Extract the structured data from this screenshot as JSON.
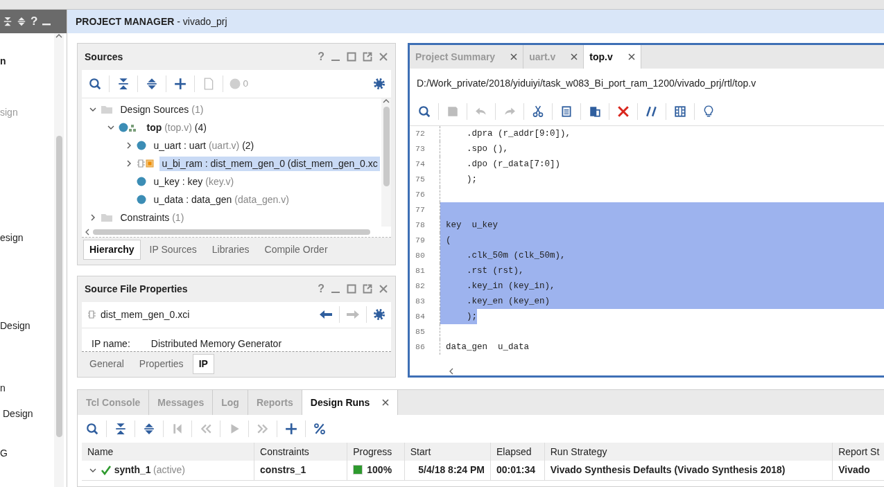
{
  "flow_navigator": {
    "help": "?",
    "items": [
      {
        "label": "n",
        "kind": "heading",
        "disabled": false
      },
      {
        "label": "sign",
        "kind": "item",
        "disabled": true
      },
      {
        "label": "esign",
        "kind": "item",
        "disabled": false
      },
      {
        "label": "Design",
        "kind": "item",
        "disabled": false
      },
      {
        "label": "n",
        "kind": "item",
        "disabled": false
      },
      {
        "label": "Design",
        "kind": "sub",
        "disabled": false
      },
      {
        "label": "G",
        "kind": "item",
        "disabled": false
      }
    ]
  },
  "header": {
    "title": "**PROJECT MANAGER** - vivado_prj"
  },
  "sources": {
    "title": "Sources",
    "help": "?",
    "toolbar": [
      {
        "kind": "search",
        "disabled": false
      },
      {
        "kind": "collapse",
        "disabled": false
      },
      {
        "kind": "expand",
        "disabled": false
      },
      {
        "kind": "plus",
        "disabled": false
      },
      {
        "kind": "doc",
        "disabled": true
      }
    ],
    "badge_count": "0",
    "tree": [
      {
        "label": "Design Sources",
        "count": "(1)",
        "kind": "folder",
        "expanded": true,
        "selected": false,
        "children": [
          {
            "label": "top",
            "file": "(top.v)",
            "count": "(4)",
            "kind": "top",
            "expanded": true,
            "selected": false,
            "children": [
              {
                "label": "u_uart : uart",
                "file": "(uart.v)",
                "count": "(2)",
                "kind": "module",
                "expanded": false,
                "selected": false
              },
              {
                "label": "u_bi_ram : dist_mem_gen_0 (dist_mem_gen_0.xc",
                "kind": "ip",
                "expanded": false,
                "selected": true
              },
              {
                "label": "u_key : key",
                "file": "(key.v)",
                "kind": "module",
                "selected": false
              },
              {
                "label": "u_data : data_gen",
                "file": "(data_gen.v)",
                "kind": "module",
                "selected": false
              }
            ]
          }
        ]
      },
      {
        "label": "Constraints",
        "count": "(1)",
        "kind": "folder",
        "expanded": false,
        "selected": false
      }
    ],
    "tabs": [
      {
        "label": "Hierarchy",
        "selected": true
      },
      {
        "label": "IP Sources",
        "selected": false
      },
      {
        "label": "Libraries",
        "selected": false
      },
      {
        "label": "Compile Order",
        "selected": false
      }
    ]
  },
  "properties": {
    "title": "Source File Properties",
    "help": "?",
    "file": "dist_mem_gen_0.xci",
    "rows": [
      {
        "name": "IP name:",
        "value": "Distributed Memory Generator"
      }
    ],
    "tabs": [
      {
        "label": "General",
        "selected": false
      },
      {
        "label": "Properties",
        "selected": false
      },
      {
        "label": "IP",
        "selected": true
      }
    ]
  },
  "editor": {
    "tabs": [
      {
        "label": "Project Summary",
        "selected": false
      },
      {
        "label": "uart.v",
        "selected": false
      },
      {
        "label": "top.v",
        "selected": true
      }
    ],
    "path": "D:/Work_private/2018/yiduiyi/task_w083_Bi_port_ram_1200/vivado_prj/rtl/top.v",
    "toolbar": [
      {
        "kind": "search",
        "disabled": false
      },
      {
        "kind": "save",
        "disabled": true
      },
      {
        "kind": "undo",
        "disabled": true
      },
      {
        "kind": "redo",
        "disabled": true
      },
      {
        "kind": "cut",
        "disabled": false
      },
      {
        "kind": "copy",
        "disabled": false
      },
      {
        "kind": "paste",
        "disabled": false
      },
      {
        "kind": "delete",
        "disabled": false
      },
      {
        "kind": "comment",
        "disabled": false
      },
      {
        "kind": "columns",
        "disabled": false
      },
      {
        "kind": "bulb",
        "disabled": false
      }
    ],
    "lines": [
      {
        "number": "72",
        "code": "    .dpra (r_addr[9:0]),",
        "selected": false
      },
      {
        "number": "73",
        "code": "    .spo (),",
        "selected": false
      },
      {
        "number": "74",
        "code": "    .dpo (r_data[7:0])",
        "selected": false
      },
      {
        "number": "75",
        "code": "    );",
        "selected": false
      },
      {
        "number": "76",
        "selected": false
      },
      {
        "number": "77",
        "selected": true
      },
      {
        "number": "78",
        "code": "key  u_key",
        "selected": true
      },
      {
        "number": "79",
        "code": "(",
        "selected": true
      },
      {
        "number": "80",
        "code": "    .clk_50m (clk_50m),",
        "selected": true
      },
      {
        "number": "81",
        "code": "    .rst (rst),",
        "selected": true
      },
      {
        "number": "82",
        "code": "    .key_in (key_in),",
        "selected": true
      },
      {
        "number": "83",
        "code": "    .key_en (key_en)",
        "selected": true
      },
      {
        "number": "84",
        "code": "    );",
        "selected": true
      },
      {
        "number": "85",
        "selected": false
      },
      {
        "number": "86",
        "code": "data_gen  u_data",
        "selected": false
      }
    ]
  },
  "runs": {
    "tabs": [
      {
        "label": "Tcl Console",
        "selected": false
      },
      {
        "label": "Messages",
        "selected": false
      },
      {
        "label": "Log",
        "selected": false
      },
      {
        "label": "Reports",
        "selected": false
      },
      {
        "label": "Design Runs",
        "selected": true
      }
    ],
    "toolbar": [
      {
        "kind": "search",
        "disabled": false
      },
      {
        "kind": "collapse",
        "disabled": false
      },
      {
        "kind": "expand",
        "disabled": false
      },
      {
        "kind": "first",
        "disabled": true
      },
      {
        "kind": "prev",
        "disabled": true
      },
      {
        "kind": "play",
        "disabled": true
      },
      {
        "kind": "next",
        "disabled": true
      },
      {
        "kind": "plus",
        "disabled": false
      },
      {
        "kind": "percent",
        "disabled": false
      }
    ],
    "columns": [
      "Name",
      "Constraints",
      "Progress",
      "Start",
      "Elapsed",
      "Run Strategy",
      "Report St"
    ],
    "rows": [
      {
        "name": "synth_1",
        "note": "(active)",
        "expanded": true,
        "complete": true,
        "constraints": "constrs_1",
        "level": 1.0,
        "progress": "100%",
        "start": "5/4/18 8:24 PM",
        "elapsed": "00:01:34",
        "strategy": "Vivado Synthesis Defaults (Vivado Synthesis 2018)",
        "report": "Vivado"
      }
    ]
  }
}
